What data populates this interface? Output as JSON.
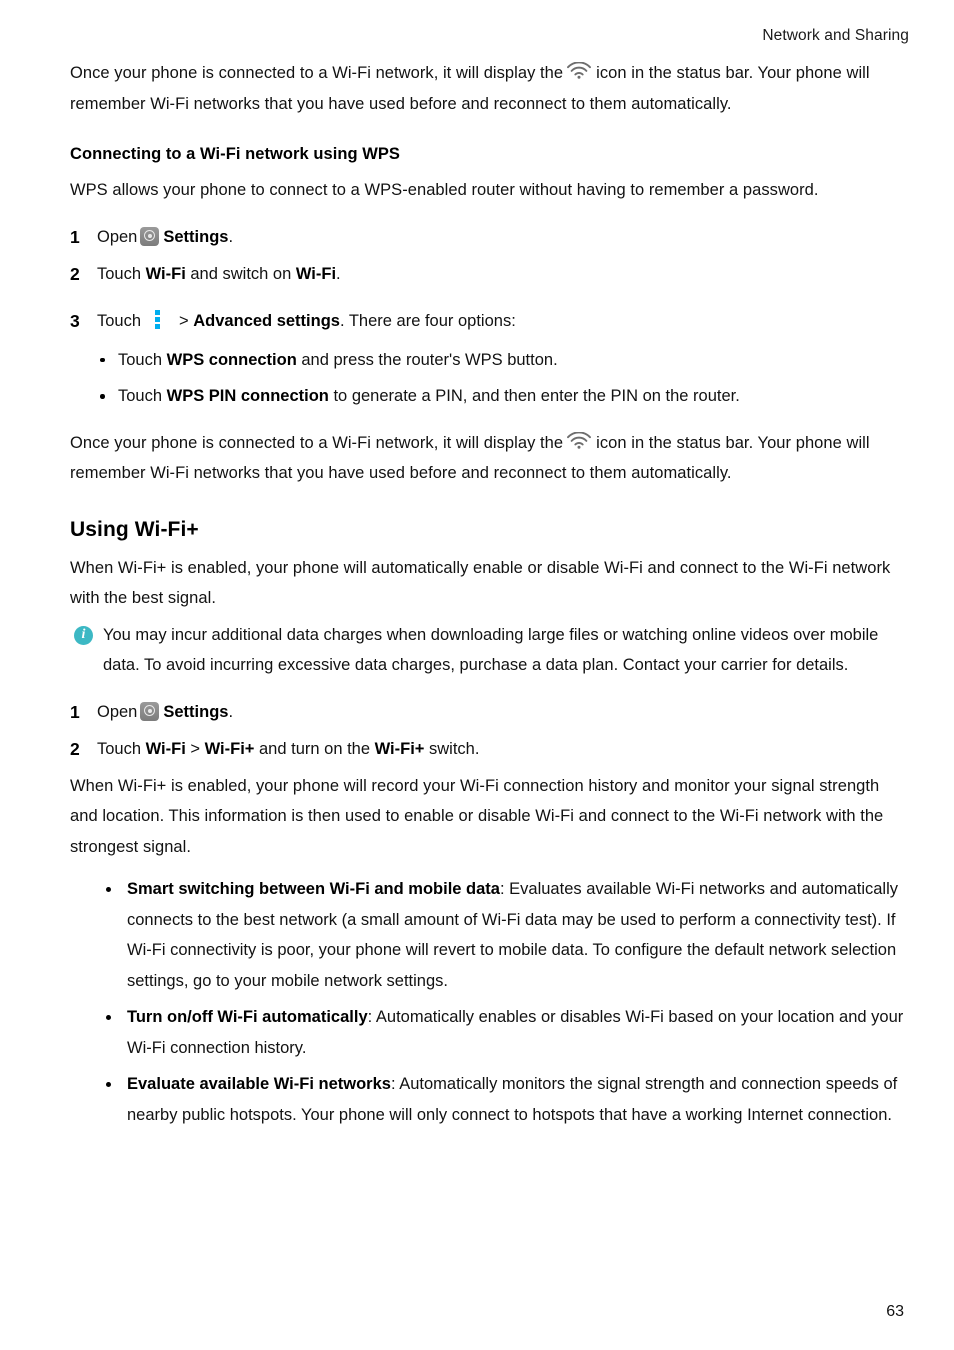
{
  "header": {
    "running_title": "Network and Sharing"
  },
  "footer": {
    "page_number": "63"
  },
  "colors": {
    "info_icon": "#3cb8c4",
    "kebab_icon": "#00aeef",
    "settings_icon": "#8a8a8a",
    "wifi_icon": "#6e6e6e",
    "text": "#121212"
  },
  "intro_paragraph": {
    "part1": "Once your phone is connected to a Wi-Fi network, it will display the",
    "icon": "wifi-icon",
    "part2": "icon in the status bar. Your phone will remember Wi-Fi networks that you have used before and reconnect to them automatically."
  },
  "wps_section": {
    "heading": "Connecting to a Wi-Fi network using WPS",
    "intro": "WPS allows your phone to connect to a WPS-enabled router without having to remember a password.",
    "steps": [
      {
        "number": "1",
        "prefix": "Open",
        "icon": "settings-icon",
        "bold": "Settings",
        "suffix": "."
      },
      {
        "number": "2",
        "prefix": "Touch",
        "bold1": "Wi-Fi",
        "middle": " and switch on ",
        "bold2": "Wi-Fi",
        "suffix": "."
      },
      {
        "number": "3",
        "prefix": "Touch",
        "icon": "kebab-menu-icon",
        "separator": ">",
        "bold": "Advanced settings",
        "suffix": ". There are four options:"
      }
    ],
    "options": [
      {
        "prefix": "Touch ",
        "bold": "WPS connection",
        "suffix": " and press the router's WPS button."
      },
      {
        "prefix": "Touch ",
        "bold": "WPS PIN connection",
        "suffix": " to generate a PIN, and then enter the PIN on the router."
      }
    ],
    "closing": {
      "part1": "Once your phone is connected to a Wi-Fi network, it will display the",
      "icon": "wifi-icon",
      "part2": "icon in the status bar. Your phone will remember Wi-Fi networks that you have used before and reconnect to them automatically."
    }
  },
  "wifiplus_section": {
    "heading": "Using Wi-Fi+",
    "intro": "When Wi-Fi+ is enabled, your phone will automatically enable or disable Wi-Fi and connect to the Wi-Fi network with the best signal.",
    "note": {
      "icon": "info-icon",
      "text": "You may incur additional data charges when downloading large files or watching online videos over mobile data. To avoid incurring excessive data charges, purchase a data plan. Contact your carrier for details."
    },
    "steps": [
      {
        "number": "1",
        "prefix": "Open",
        "icon": "settings-icon",
        "bold": "Settings",
        "suffix": "."
      },
      {
        "number": "2",
        "prefix": "Touch ",
        "bold1": "Wi-Fi",
        "sep": " > ",
        "bold2": "Wi-Fi+",
        "middle": " and turn on the ",
        "bold3": "Wi-Fi+",
        "suffix": " switch."
      }
    ],
    "step2_detail": "When Wi-Fi+ is enabled, your phone will record your Wi-Fi connection history and monitor your signal strength and location. This information is then used to enable or disable Wi-Fi and connect to the Wi-Fi network with the strongest signal.",
    "features": [
      {
        "bold": "Smart switching between Wi-Fi and mobile data",
        "text": ": Evaluates available Wi-Fi networks and automatically connects to the best network (a small amount of Wi-Fi data may be used to perform a connectivity test). If Wi-Fi connectivity is poor, your phone will revert to mobile data. To configure the default network selection settings, go to your mobile network settings."
      },
      {
        "bold": "Turn on/off Wi-Fi automatically",
        "text": ": Automatically enables or disables Wi-Fi based on your location and your Wi-Fi connection history."
      },
      {
        "bold": "Evaluate available Wi-Fi networks",
        "text": ": Automatically monitors the signal strength and connection speeds of nearby public hotspots. Your phone will only connect to hotspots that have a working Internet connection."
      }
    ]
  }
}
